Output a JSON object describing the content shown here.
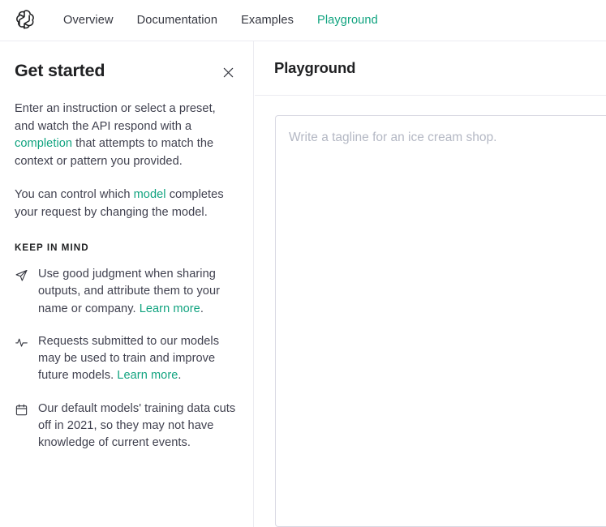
{
  "nav": {
    "logo_icon": "openai-logo-icon",
    "links": [
      {
        "label": "Overview",
        "active": false
      },
      {
        "label": "Documentation",
        "active": false
      },
      {
        "label": "Examples",
        "active": false
      },
      {
        "label": "Playground",
        "active": true
      }
    ]
  },
  "sidebar": {
    "title": "Get started",
    "close_icon": "close-icon",
    "paragraph1": {
      "before": "Enter an instruction or select a preset, and watch the API respond with a ",
      "link": "completion",
      "after": " that attempts to match the context or pattern you provided."
    },
    "paragraph2": {
      "before": "You can control which ",
      "link": "model",
      "after": " completes your request by changing the model."
    },
    "keep_in_mind_label": "KEEP IN MIND",
    "bullets": [
      {
        "icon": "send-icon",
        "text": "Use good judgment when sharing outputs, and attribute them to your name or company. ",
        "link": "Learn more",
        "text_after": "."
      },
      {
        "icon": "activity-icon",
        "text": "Requests submitted to our models may be used to train and improve future models. ",
        "link": "Learn more",
        "text_after": "."
      },
      {
        "icon": "calendar-icon",
        "text": "Our default models' training data cuts off in 2021, so they may not have knowledge of current events.",
        "link": "",
        "text_after": ""
      }
    ]
  },
  "main": {
    "title": "Playground",
    "prompt_placeholder": "Write a tagline for an ice cream shop.",
    "prompt_value": ""
  },
  "colors": {
    "accent": "#10a37f",
    "text": "#353740",
    "heading": "#202123",
    "border": "#ececf1",
    "input_border": "#d9d9e3",
    "placeholder": "#b4b8c4"
  }
}
